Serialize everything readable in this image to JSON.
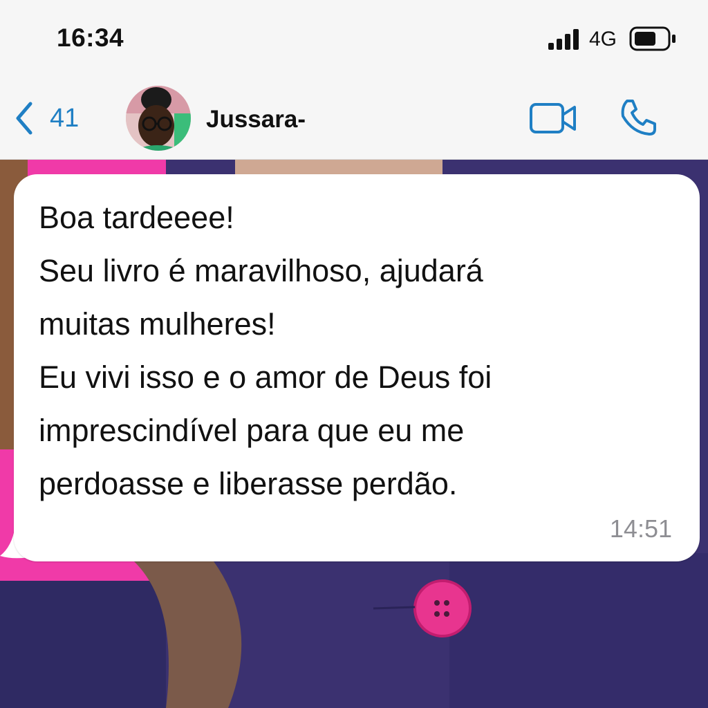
{
  "status_bar": {
    "time": "16:34",
    "network": "4G",
    "signal_icon": "cellular-signal-icon",
    "battery_icon": "battery-icon"
  },
  "header": {
    "back_count": "41",
    "back_icon": "chevron-left-icon",
    "contact_name": "Jussara-",
    "video_icon": "video-camera-icon",
    "call_icon": "phone-icon",
    "accent_color": "#1f7fc4"
  },
  "message": {
    "lines": [
      "Boa tardeeee!",
      "Seu livro é maravilhoso, ajudará",
      "muitas mulheres!",
      "Eu vivi isso e o amor de Deus foi",
      "imprescindível para que eu me",
      "perdoasse e liberasse perdão."
    ],
    "time": "14:51"
  }
}
